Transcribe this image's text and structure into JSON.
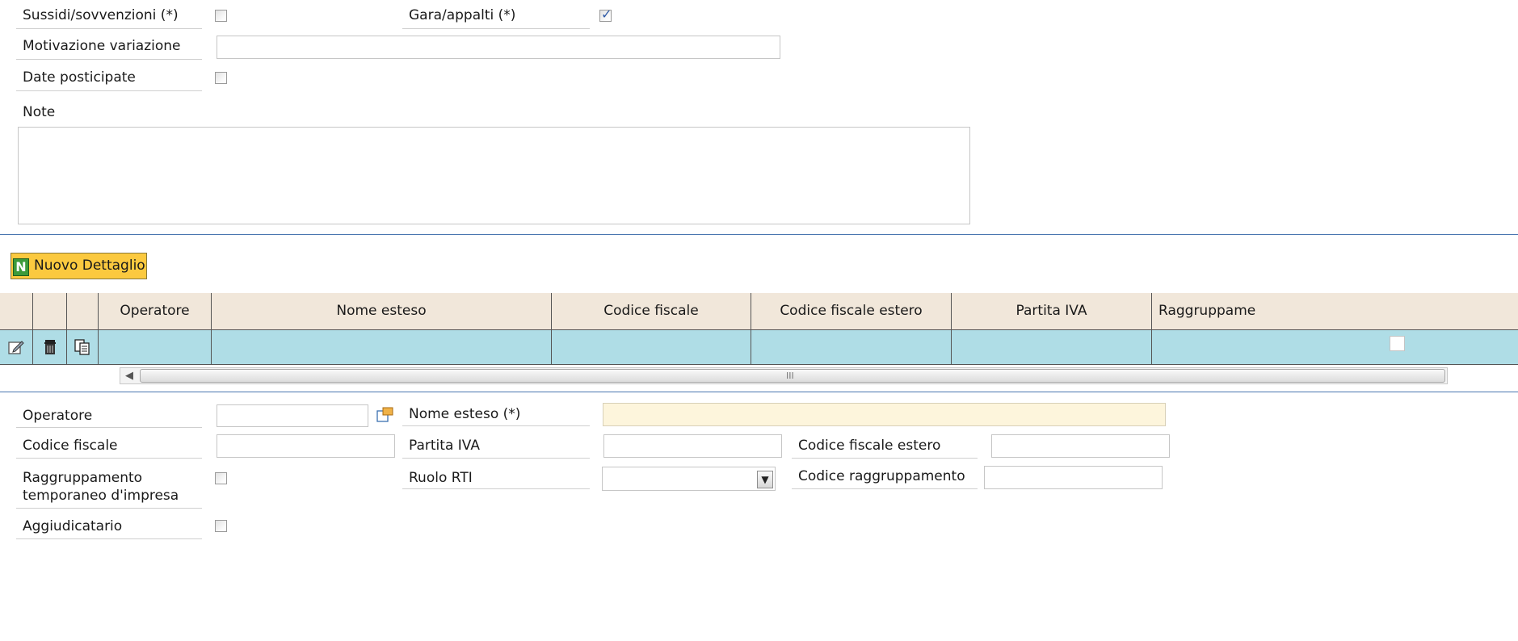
{
  "form": {
    "sussidi_label": "Sussidi/sovvenzioni (*)",
    "sussidi_checked": false,
    "gara_label": "Gara/appalti (*)",
    "gara_checked": true,
    "motivazione_label": "Motivazione variazione",
    "motivazione_value": "",
    "date_posticipate_label": "Date posticipate",
    "date_posticipate_checked": false,
    "note_label": "Note",
    "note_value": ""
  },
  "toolbar": {
    "new_detail_label": "Nuovo Dettaglio",
    "new_detail_icon_glyph": "N"
  },
  "grid": {
    "columns": [
      "Operatore",
      "Nome esteso",
      "Codice fiscale",
      "Codice fiscale estero",
      "Partita IVA",
      "Raggruppame"
    ],
    "row": {
      "operatore": "",
      "nome_esteso": "",
      "codice_fiscale": "",
      "codice_fiscale_estero": "",
      "partita_iva": "",
      "raggruppamento_checked": false
    },
    "icons": [
      "edit-icon",
      "trash-icon",
      "copy-icon"
    ]
  },
  "scrollbar": {
    "left_arrow": "◀",
    "grip": "III"
  },
  "detail": {
    "operatore_label": "Operatore",
    "operatore_value": "",
    "nome_esteso_label": "Nome esteso (*)",
    "nome_esteso_value": "",
    "codice_fiscale_label": "Codice fiscale",
    "codice_fiscale_value": "",
    "partita_iva_label": "Partita IVA",
    "partita_iva_value": "",
    "codice_fiscale_estero_label": "Codice fiscale estero",
    "codice_fiscale_estero_value": "",
    "rti_label_line1": "Raggruppamento",
    "rti_label_line2": "temporaneo d'impresa",
    "rti_checked": false,
    "ruolo_rti_label": "Ruolo RTI",
    "ruolo_rti_value": "",
    "codice_raggruppamento_label": "Codice raggruppamento",
    "codice_raggruppamento_value": "",
    "aggiudicatario_label": "Aggiudicatario",
    "aggiudicatario_checked": false
  },
  "colors": {
    "header_bg": "#f1e7da",
    "row_bg": "#afdde6",
    "button_bg": "#fbc93f",
    "required_bg": "#fdf5dc",
    "separator": "#4a76b0"
  }
}
